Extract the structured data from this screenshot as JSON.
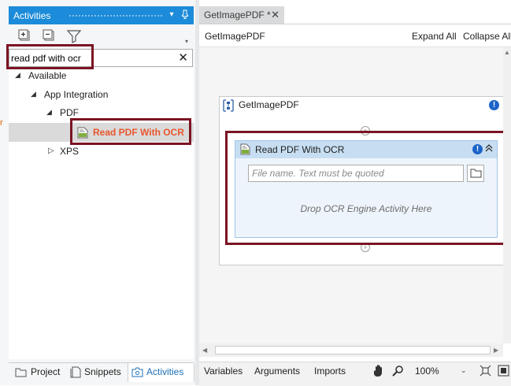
{
  "activities_panel": {
    "title": "Activities",
    "search": {
      "value": "read pdf with ocr"
    },
    "tree": [
      {
        "label": "Available"
      },
      {
        "label": "App Integration"
      },
      {
        "label": "PDF"
      },
      {
        "label": "Read PDF With OCR"
      },
      {
        "label": "XPS"
      }
    ],
    "bottom_tabs": [
      {
        "label": "Project"
      },
      {
        "label": "Snippets"
      },
      {
        "label": "Activities"
      }
    ]
  },
  "document_tab": {
    "label": "GetImagePDF *"
  },
  "designer": {
    "breadcrumb": "GetImagePDF",
    "expand_all": "Expand All",
    "collapse_all": "Collapse All",
    "sequence": {
      "title": "GetImagePDF"
    },
    "activity": {
      "title": "Read PDF With OCR",
      "file_placeholder": "File name. Text must be quoted",
      "drop_hint": "Drop OCR Engine Activity Here"
    }
  },
  "bottom_bar": {
    "variables": "Variables",
    "arguments": "Arguments",
    "imports": "Imports",
    "zoom": "100%"
  },
  "colors": {
    "accent": "#1c8bd9",
    "highlight_box": "#7b1423",
    "search_match": "#e8572d",
    "activity_header": "#c7def2",
    "warning": "#1c64c8"
  }
}
